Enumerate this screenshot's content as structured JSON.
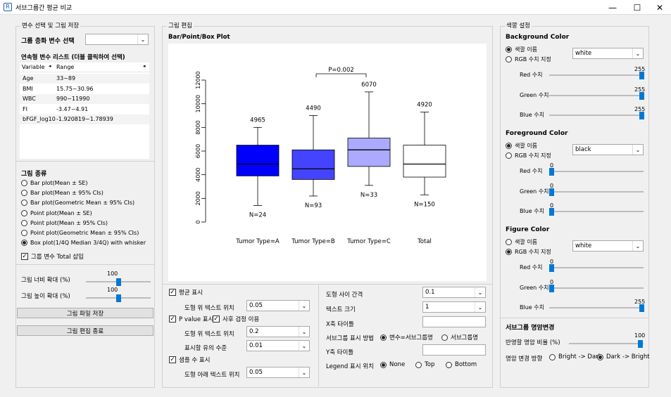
{
  "window": {
    "title": "서브그룹간 평균 비교",
    "min": "—",
    "max": "☐",
    "close": "✕"
  },
  "left": {
    "group_title": "변수 선택 및 그림 저장",
    "group_var_label": "그룹 층화 변수 선택",
    "group_var_value": "",
    "cont_list_title": "연속형 변수 리스트 (더블 클릭하여 선택)",
    "table": {
      "col_variable": "Variable",
      "col_range": "Range",
      "rows": [
        {
          "var": "Age",
          "range": "33~89"
        },
        {
          "var": "BMI",
          "range": "15.75~30.96"
        },
        {
          "var": "WBC",
          "range": "990~11990"
        },
        {
          "var": "FI",
          "range": "-3.47~4.91"
        },
        {
          "var": "bFGF_log10",
          "range": "-1.920819~1.78939"
        }
      ]
    },
    "plot_type_title": "그림 종류",
    "plot_types": [
      "Bar plot(Mean ± SE)",
      "Bar plot(Mean ± 95% CIs)",
      "Bar plot(Geometric Mean ± 95% CIs)",
      "Point plot(Mean ± SE)",
      "Point plot(Mean ± 95% CIs)",
      "Point plot(Geometric Mean ± 95% CIs)",
      "Box plot(1/4Q Median 3/4Q) with whisker"
    ],
    "selected_plot": 6,
    "total_insert": "그룹 변수 Total 삽입",
    "width_label": "그림 너비 확대 (%)",
    "width_value": "100",
    "width_level": 0.5,
    "height_label": "그림 높이 확대 (%)",
    "height_value": "100",
    "height_level": 0.5,
    "save_button": "그림 파일 저장",
    "close_button": "그림 편집 종료"
  },
  "center": {
    "group_title": "그림 편집",
    "plot_title": "Bar/Point/Box Plot",
    "pvalue": "P=0.002",
    "options": {
      "mean_show": "평균 표시",
      "text_pos_label": "도형 위 텍스트 위치",
      "text_pos_value": "0.05",
      "pvalue_show": "P value 표시",
      "posthoc": "사후 검정 이용",
      "text_pos2_label": "도형 위 텍스트 위치",
      "text_pos2_value": "0.2",
      "sig_label": "표시할 유의 수준",
      "sig_value": "0.01",
      "sample_show": "샘플 수 표시",
      "below_pos_label": "도형 아래 텍스트 위치",
      "below_pos_value": "0.05",
      "gap_label": "도형 사이 간격",
      "gap_value": "0.1",
      "textsize_label": "텍스트 크기",
      "textsize_value": "1",
      "xtitle_label": "X축 타이틀",
      "subgroup_label": "서브그룹 표시 방법",
      "subgroup_opt1": "변수=서브그룹명",
      "subgroup_opt2": "서브그룹명",
      "ytitle_label": "Y축 타이틀",
      "legend_label": "Legend 표시 위치",
      "legend_none": "None",
      "legend_top": "Top",
      "legend_bottom": "Bottom"
    }
  },
  "right": {
    "group_title": "색깔 설정",
    "bg": {
      "title": "Background Color",
      "opt_name": "색깔 이름",
      "opt_rgb": "RGB 수치 지정",
      "value": "white",
      "red": "255",
      "green": "255",
      "blue": "255",
      "selected": 0
    },
    "fg": {
      "title": "Foreground Color",
      "opt_name": "색깔 이름",
      "opt_rgb": "RGB 수치 지정",
      "value": "black",
      "red": "0",
      "green": "0",
      "blue": "0",
      "selected": 0
    },
    "fig": {
      "title": "Figure Color",
      "opt_name": "색깔 이름",
      "opt_rgb": "RGB 수치 지정",
      "value": "white",
      "red": "0",
      "green": "0",
      "blue": "255",
      "selected": 1
    },
    "red_label": "Red 수치",
    "green_label": "Green 수치",
    "blue_label": "Blue 수치",
    "bright_title": "서브그룹 명암변경",
    "ratio_label": "반영할 명암 비율 (%)",
    "ratio_value": "100",
    "dir_label": "명암 변경 방향",
    "dir_opt1": "Bright -> Dark",
    "dir_opt2": "Dark -> Bright"
  },
  "chart_data": {
    "type": "box",
    "categories": [
      "Tumor Type=A",
      "Tumor Type=B",
      "Tumor Type=C",
      "Total"
    ],
    "ylim": [
      0,
      12000
    ],
    "yticks": [
      "0",
      "2000",
      "4000",
      "6000",
      "8000",
      "10000",
      "12000"
    ],
    "boxes": [
      {
        "whisker_low": 1400,
        "q1": 3900,
        "median": 4900,
        "q3": 6500,
        "whisker_high": 8000,
        "color": "#0000ff",
        "top_label": "4965",
        "n_label": "N=24"
      },
      {
        "whisker_low": 2200,
        "q1": 3600,
        "median": 4500,
        "q3": 6100,
        "whisker_high": 9000,
        "color": "#4444ff",
        "top_label": "4490",
        "n_label": "N=93"
      },
      {
        "whisker_low": 3100,
        "q1": 4700,
        "median": 6100,
        "q3": 7100,
        "whisker_high": 11000,
        "color": "#aaaaff",
        "top_label": "6070",
        "n_label": "N=33"
      },
      {
        "whisker_low": 2300,
        "q1": 3800,
        "median": 4900,
        "q3": 6500,
        "whisker_high": 9300,
        "color": "#ffffff",
        "top_label": "4920",
        "n_label": "N=150"
      }
    ],
    "bracket": {
      "from": 1,
      "to": 2,
      "label": "P=0.002"
    }
  }
}
